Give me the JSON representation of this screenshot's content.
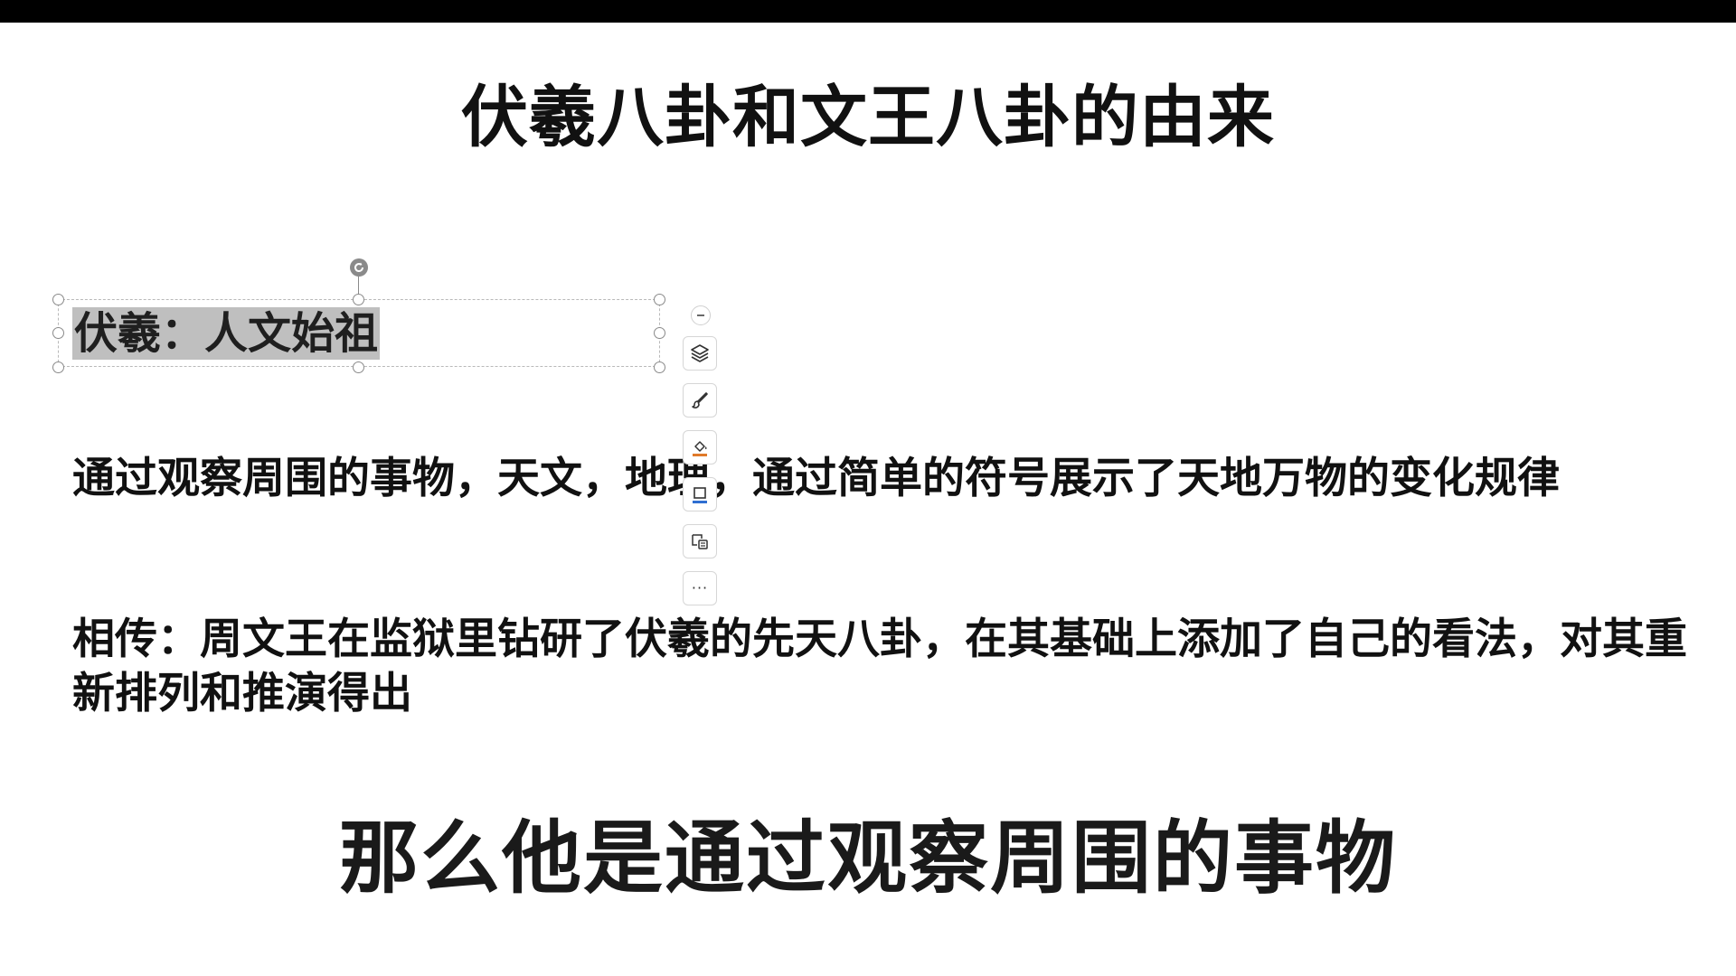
{
  "slide": {
    "title": "伏羲八卦和文王八卦的由来",
    "selected_textbox": {
      "text": "伏羲：人文始祖"
    },
    "paragraph_1": "通过观察周围的事物，天文，地理，通过简单的符号展示了天地万物的变化规律",
    "paragraph_2": "相传：周文王在监狱里钻研了伏羲的先天八卦，在其基础上添加了自己的看法，对其重新排列和推演得出"
  },
  "floating_toolbar": {
    "items": [
      {
        "icon": "collapse-icon"
      },
      {
        "icon": "layers-icon"
      },
      {
        "icon": "brush-icon"
      },
      {
        "icon": "shape-fill-icon"
      },
      {
        "icon": "shape-outline-icon"
      },
      {
        "icon": "text-options-icon"
      },
      {
        "icon": "more-icon",
        "label": "···"
      }
    ]
  },
  "subtitle": {
    "text": "那么他是通过观察周围的事物"
  },
  "colors": {
    "top_bar": "#000000",
    "selection_highlight": "#bfbfbf",
    "fill_accent": "#e07a2a",
    "outline_accent": "#2f6fd1"
  }
}
